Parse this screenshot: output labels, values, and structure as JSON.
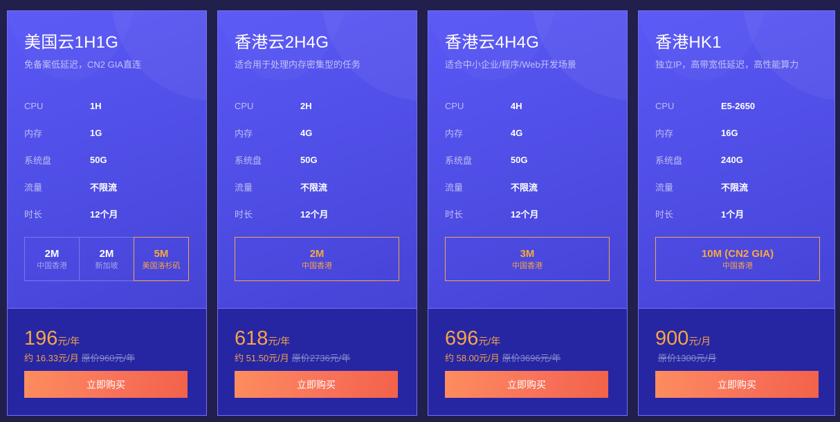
{
  "spec_labels": [
    "CPU",
    "内存",
    "系统盘",
    "流量",
    "时长"
  ],
  "plans": [
    {
      "title": "美国云1H1G",
      "subtitle": "免备案低延迟，CN2 GIA直连",
      "specs": [
        "1H",
        "1G",
        "50G",
        "不限流",
        "12个月"
      ],
      "bandwidth_options": [
        {
          "speed": "2M",
          "location": "中国香港",
          "selected": false
        },
        {
          "speed": "2M",
          "location": "新加坡",
          "selected": false
        },
        {
          "speed": "5M",
          "location": "美国洛杉矶",
          "selected": true
        }
      ],
      "price": "196",
      "price_unit": "元/年",
      "monthly": "约 16.33元/月",
      "original_price": "原价960元/年",
      "buy_label": "立即购买"
    },
    {
      "title": "香港云2H4G",
      "subtitle": "适合用于处理内存密集型的任务",
      "specs": [
        "2H",
        "4G",
        "50G",
        "不限流",
        "12个月"
      ],
      "bandwidth_options": [
        {
          "speed": "2M",
          "location": "中国香港",
          "selected": true
        }
      ],
      "price": "618",
      "price_unit": "元/年",
      "monthly": "约 51.50元/月",
      "original_price": "原价2736元/年",
      "buy_label": "立即购买"
    },
    {
      "title": "香港云4H4G",
      "subtitle": "适合中小企业/程序/Web开发场景",
      "specs": [
        "4H",
        "4G",
        "50G",
        "不限流",
        "12个月"
      ],
      "bandwidth_options": [
        {
          "speed": "3M",
          "location": "中国香港",
          "selected": true
        }
      ],
      "price": "696",
      "price_unit": "元/年",
      "monthly": "约 58.00元/月",
      "original_price": "原价3696元/年",
      "buy_label": "立即购买"
    },
    {
      "title": "香港HK1",
      "subtitle": "独立IP，高带宽低延迟，高性能算力",
      "specs": [
        "E5-2650",
        "16G",
        "240G",
        "不限流",
        "1个月"
      ],
      "bandwidth_options": [
        {
          "speed": "10M (CN2 GIA)",
          "location": "中国香港",
          "selected": true
        }
      ],
      "price": "900",
      "price_unit": "元/月",
      "monthly": "",
      "original_price": "原价1300元/月",
      "buy_label": "立即购买"
    }
  ],
  "colors": {
    "page_background": "#211f4c",
    "card_top": "#5654f2",
    "card_bottom": "#2626a3",
    "card_border": "#7571f5",
    "accent_orange": "#f6a446",
    "button_gradient_start": "#fd8d5e",
    "button_gradient_end": "#f26249"
  }
}
